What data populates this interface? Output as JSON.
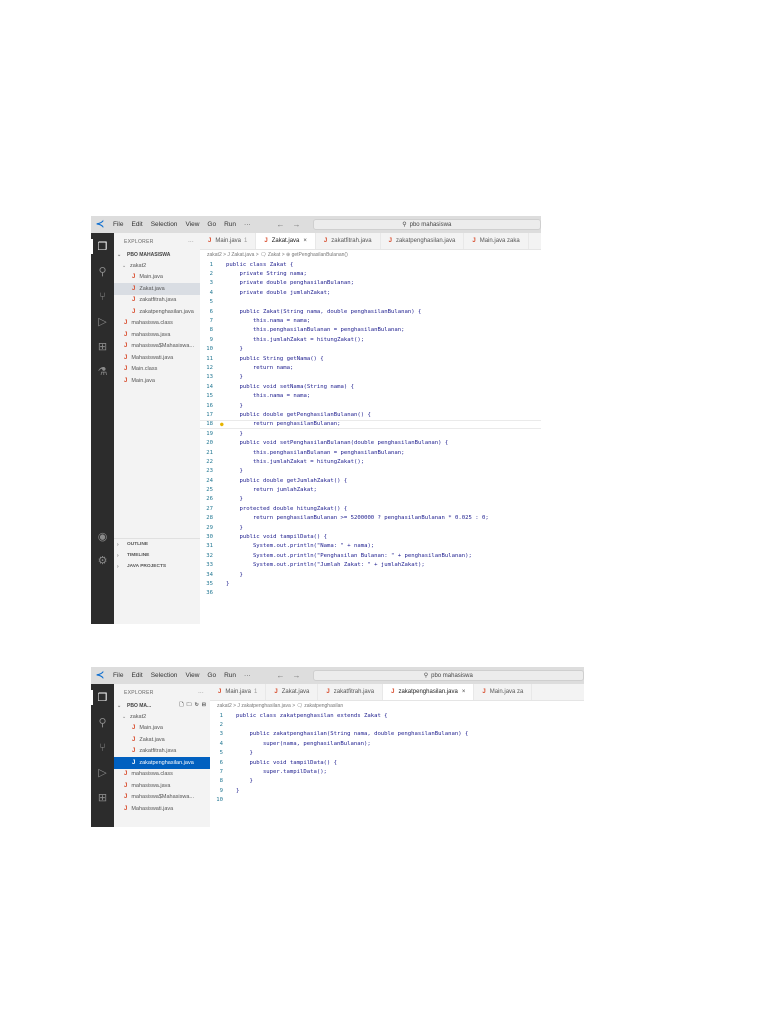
{
  "menu": [
    "File",
    "Edit",
    "Selection",
    "View",
    "Go",
    "Run",
    "···"
  ],
  "nav": [
    "←",
    "→"
  ],
  "search_placeholder": "pbo mahasiswa",
  "screens": [
    {
      "explorer_title": "EXPLORER",
      "explorer_more": "···",
      "project": "PBO MAHASISWA",
      "tree": [
        {
          "label": "zakat2",
          "type": "folder"
        },
        {
          "label": "Main.java",
          "type": "java"
        },
        {
          "label": "Zakat.java",
          "type": "java"
        },
        {
          "label": "zakatfitrah.java",
          "type": "java"
        },
        {
          "label": "zakatpenghasilan.java",
          "type": "java"
        },
        {
          "label": "mahasiswa.class",
          "type": "java"
        },
        {
          "label": "mahasiswa.java",
          "type": "java"
        },
        {
          "label": "mahasiswa$Mahasiswa...",
          "type": "java"
        },
        {
          "label": "Mahasiswati.java",
          "type": "java"
        },
        {
          "label": "Main.class",
          "type": "java"
        },
        {
          "label": "Main.java",
          "type": "java"
        }
      ],
      "sections": [
        "OUTLINE",
        "TIMELINE",
        "JAVA PROJECTS"
      ],
      "tabs": [
        {
          "label": "Main.java",
          "mod": "1"
        },
        {
          "label": "Zakat.java",
          "mod": ""
        },
        {
          "label": "zakatfitrah.java",
          "mod": ""
        },
        {
          "label": "zakatpenghasilan.java",
          "mod": ""
        },
        {
          "label": "Main.java zaka",
          "mod": ""
        }
      ],
      "breadcrumb": "zakat2 > J Zakat.java > 🗨 Zakat > ⊕ getPenghasilanBulanan()",
      "code": [
        "public class Zakat {",
        "    private String nama;",
        "    private double penghasilanBulanan;",
        "    private double jumlahZakat;",
        "",
        "    public Zakat(String nama, double penghasilanBulanan) {",
        "        this.nama = nama;",
        "        this.penghasilanBulanan = penghasilanBulanan;",
        "        this.jumlahZakat = hitungZakat();",
        "    }",
        "    public String getNama() {",
        "        return nama;",
        "    }",
        "    public void setNama(String nama) {",
        "        this.nama = nama;",
        "    }",
        "    public double getPenghasilanBulanan() {",
        "        return penghasilanBulanan;",
        "    }",
        "    public void setPenghasilanBulanan(double penghasilanBulanan) {",
        "        this.penghasilanBulanan = penghasilanBulanan;",
        "        this.jumlahZakat = hitungZakat();",
        "    }",
        "    public double getJumlahZakat() {",
        "        return jumlahZakat;",
        "    }",
        "    protected double hitungZakat() {",
        "        return penghasilanBulanan >= 5200000 ? penghasilanBulanan * 0.025 : 0;",
        "    }",
        "    public void tampilData() {",
        "        System.out.println(\"Nama: \" + nama);",
        "        System.out.println(\"Penghasilan Bulanan: \" + penghasilanBulanan);",
        "        System.out.println(\"Jumlah Zakat: \" + jumlahZakat);",
        "    }",
        "}",
        ""
      ]
    },
    {
      "explorer_title": "EXPLORER",
      "explorer_more": "···",
      "project": "PBO MA...",
      "tree": [
        {
          "label": "zakat2",
          "type": "folder"
        },
        {
          "label": "Main.java",
          "type": "java"
        },
        {
          "label": "Zakat.java",
          "type": "java"
        },
        {
          "label": "zakatfitrah.java",
          "type": "java"
        },
        {
          "label": "zakatpenghasilan.java",
          "type": "java"
        },
        {
          "label": "mahasiswa.class",
          "type": "java"
        },
        {
          "label": "mahasiswa.java",
          "type": "java"
        },
        {
          "label": "mahasiswa$Mahasiswa...",
          "type": "java"
        },
        {
          "label": "Mahasiswati.java",
          "type": "java"
        }
      ],
      "tabs": [
        {
          "label": "Main.java",
          "mod": "1"
        },
        {
          "label": "Zakat.java",
          "mod": ""
        },
        {
          "label": "zakatfitrah.java",
          "mod": ""
        },
        {
          "label": "zakatpenghasilan.java",
          "mod": ""
        },
        {
          "label": "Main.java za",
          "mod": ""
        }
      ],
      "breadcrumb": "zakat2 > J zakatpenghasilan.java > 🗨 zakatpenghasilan",
      "code": [
        "public class zakatpenghasilan extends Zakat {",
        "",
        "    public zakatpenghasilan(String nama, double penghasilanBulanan) {",
        "        super(nama, penghasilanBulanan);",
        "    }",
        "    public void tampilData() {",
        "        super.tampilData();",
        "    }",
        "}",
        ""
      ]
    }
  ]
}
